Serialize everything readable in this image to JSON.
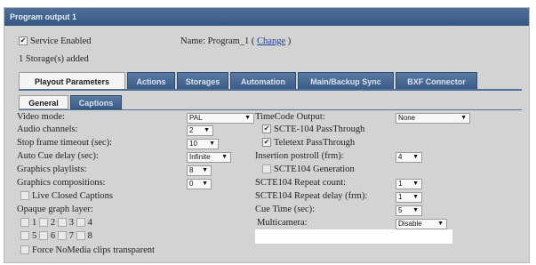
{
  "panel": {
    "title": "Program output 1"
  },
  "top": {
    "service_enabled_label": "Service Enabled",
    "name_label": "Name:",
    "name_value": "Program_1",
    "paren_open": "(",
    "paren_close": ")",
    "change_link": "Change",
    "storage_text": "1 Storage(s) added"
  },
  "tabs": [
    {
      "label": "Playout Parameters"
    },
    {
      "label": "Actions"
    },
    {
      "label": "Storages"
    },
    {
      "label": "Automation"
    },
    {
      "label": "Main/Backup Sync"
    },
    {
      "label": "BXF Connector"
    }
  ],
  "subtabs": [
    {
      "label": "General"
    },
    {
      "label": "Captions"
    }
  ],
  "left": {
    "video_mode": {
      "label": "Video mode:",
      "value": "PAL"
    },
    "audio_channels": {
      "label": "Audio channels:",
      "value": "2"
    },
    "stop_frame_timeout": {
      "label": "Stop frame timeout (sec):",
      "value": "10"
    },
    "auto_cue_delay": {
      "label": "Auto Cue delay (sec):",
      "value": "Infinite"
    },
    "graphics_playlists": {
      "label": "Graphics playlists:",
      "value": "8"
    },
    "graphics_compositions": {
      "label": "Graphics compositions:",
      "value": "0"
    },
    "live_closed_captions": {
      "label": "Live Closed Captions"
    },
    "opaque_graph_layer": {
      "label": "Opaque graph layer:"
    },
    "layers": [
      "1",
      "2",
      "3",
      "4",
      "5",
      "6",
      "7",
      "8"
    ],
    "force_nomedia": {
      "label": "Force NoMedia clips transparent"
    }
  },
  "right": {
    "timecode_output": {
      "label": "TimeCode Output:",
      "value": "None"
    },
    "scte104_passthrough": {
      "label": "SCTE-104 PassThrough"
    },
    "teletext_passthrough": {
      "label": "Teletext PassThrough"
    },
    "insertion_postroll": {
      "label": "Insertion postroll (frm):",
      "value": "4"
    },
    "scte104_generation": {
      "label": "SCTE104 Generation"
    },
    "scte104_repeat_count": {
      "label": "SCTE104 Repeat count:",
      "value": "1"
    },
    "scte104_repeat_delay": {
      "label": "SCTE104 Repeat delay (frm):",
      "value": "1"
    },
    "cue_time": {
      "label": "Cue Time (sec):",
      "value": "5"
    },
    "multicamera": {
      "label": "Multicamera:",
      "value": "Disable"
    }
  },
  "glyphs": {
    "arrow": "▼",
    "check": "✔"
  },
  "colors": {
    "header": "#3f6090",
    "panel": "#d3d3d3",
    "link": "#1f3d9c"
  }
}
